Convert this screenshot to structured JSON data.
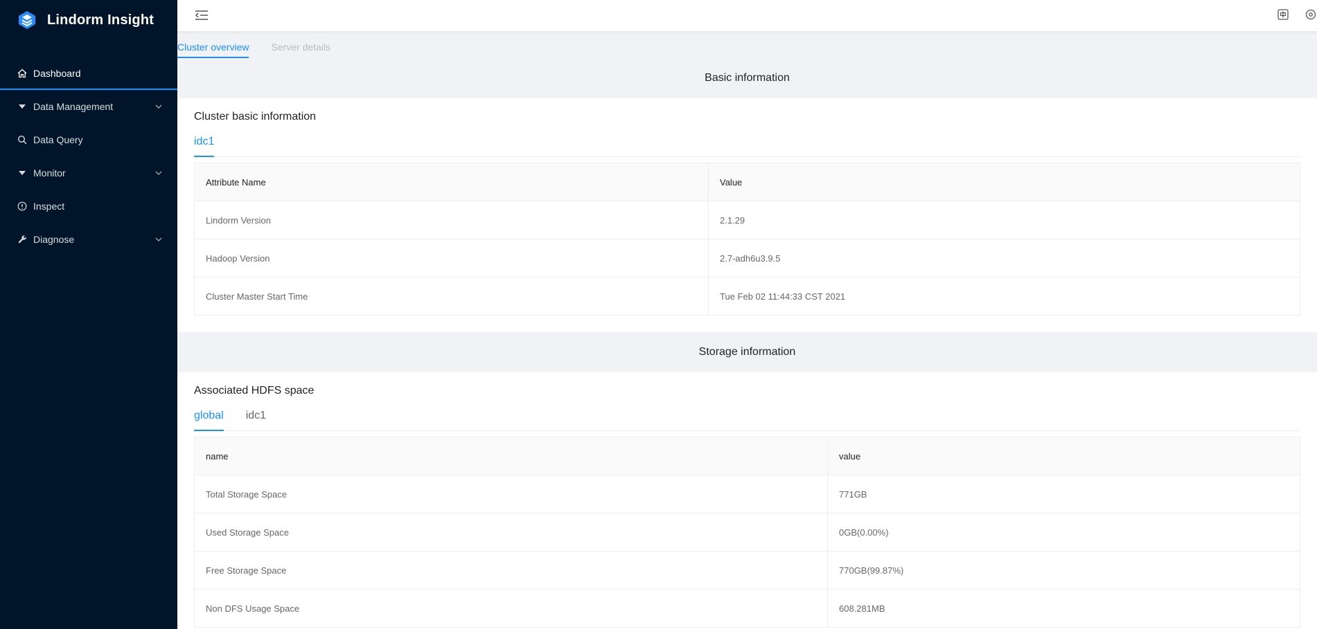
{
  "brand": {
    "title": "Lindorm Insight"
  },
  "sidebar": {
    "items": [
      {
        "label": "Dashboard",
        "icon": "home-icon",
        "active": true
      },
      {
        "label": "Data Management",
        "icon": "caret-down-icon",
        "expandable": true
      },
      {
        "label": "Data Query",
        "icon": "search-icon"
      },
      {
        "label": "Monitor",
        "icon": "caret-down-icon",
        "expandable": true
      },
      {
        "label": "Inspect",
        "icon": "info-circle-icon"
      },
      {
        "label": "Diagnose",
        "icon": "wrench-icon",
        "expandable": true
      }
    ]
  },
  "topbar": {
    "fold_icon": "menu-fold-icon",
    "right_icons": [
      "language-icon",
      "settings-icon"
    ]
  },
  "page_tabs": [
    {
      "label": "Cluster overview",
      "active": true
    },
    {
      "label": "Server details",
      "active": false
    }
  ],
  "basic": {
    "section_title": "Basic information",
    "card_title": "Cluster basic information",
    "tabs": [
      "idc1"
    ],
    "headers": [
      "Attribute Name",
      "Value"
    ],
    "rows": [
      [
        "Lindorm Version",
        "2.1.29"
      ],
      [
        "Hadoop Version",
        "2.7-adh6u3.9.5"
      ],
      [
        "Cluster Master Start Time",
        "Tue Feb 02 11:44:33 CST 2021"
      ]
    ]
  },
  "storage": {
    "section_title": "Storage information",
    "card_title": "Associated HDFS space",
    "tabs": [
      "global",
      "idc1"
    ],
    "headers": [
      "name",
      "value"
    ],
    "rows": [
      [
        "Total Storage Space",
        "771GB"
      ],
      [
        "Used Storage Space",
        "0GB(0.00%)"
      ],
      [
        "Free Storage Space",
        "770GB(99.87%)"
      ],
      [
        "Non DFS Usage Space",
        "608.281MB"
      ]
    ]
  },
  "colors": {
    "sidebar_bg": "#001529",
    "accent": "#1890ff",
    "section_bg": "#f0f2f5"
  }
}
